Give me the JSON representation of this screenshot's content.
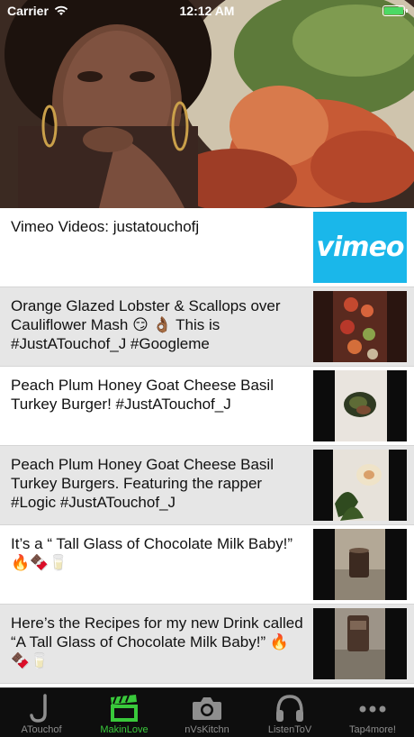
{
  "status_bar": {
    "carrier": "Carrier",
    "time": "12:12 AM",
    "battery_color": "#4cd964"
  },
  "hero": {
    "description_icon": "photo-icon"
  },
  "videos": [
    {
      "title": "Vimeo Videos: justatouchofj",
      "thumb": "vimeo-logo",
      "thumb_text": "vimeo",
      "style": "plain"
    },
    {
      "title": "Orange Glazed Lobster & Scallops over Cauliflower Mash 😏 👌🏾  This is #JustATouchof_J #Googleme",
      "thumb": "lobster-video",
      "style": "alt"
    },
    {
      "title": "Peach Plum Honey Goat Cheese Basil Turkey Burger!  #JustATouchof_J",
      "thumb": "burger-video",
      "style": "plain"
    },
    {
      "title": "Peach Plum Honey Goat Cheese Basil Turkey Burgers. Featuring the rapper #Logic #JustATouchof_J",
      "thumb": "burgers-logic-video",
      "style": "alt"
    },
    {
      "title": "It’s a “ Tall Glass of Chocolate Milk Baby!” 🔥🍫🥛",
      "thumb": "chocolate-milk-video",
      "style": "plain"
    },
    {
      "title": "Here’s the Recipes for my new Drink called “A Tall Glass of Chocolate Milk Baby!” 🔥🍫🥛",
      "thumb": "drink-recipe-video",
      "style": "alt"
    }
  ],
  "tabs": [
    {
      "label": "ATouchof",
      "icon": "letter-j-icon",
      "active": false
    },
    {
      "label": "MakinLove",
      "icon": "clapperboard-icon",
      "active": true
    },
    {
      "label": "nVsKitchn",
      "icon": "camera-icon",
      "active": false
    },
    {
      "label": "ListenToV",
      "icon": "headphones-icon",
      "active": false
    },
    {
      "label": "Tap4more!",
      "icon": "more-icon",
      "active": false
    }
  ],
  "colors": {
    "tab_active": "#39c93b",
    "tab_inactive": "#8e8e8e",
    "tab_bar_bg": "#0e0e0e",
    "vimeo_blue": "#1ab7ea"
  }
}
